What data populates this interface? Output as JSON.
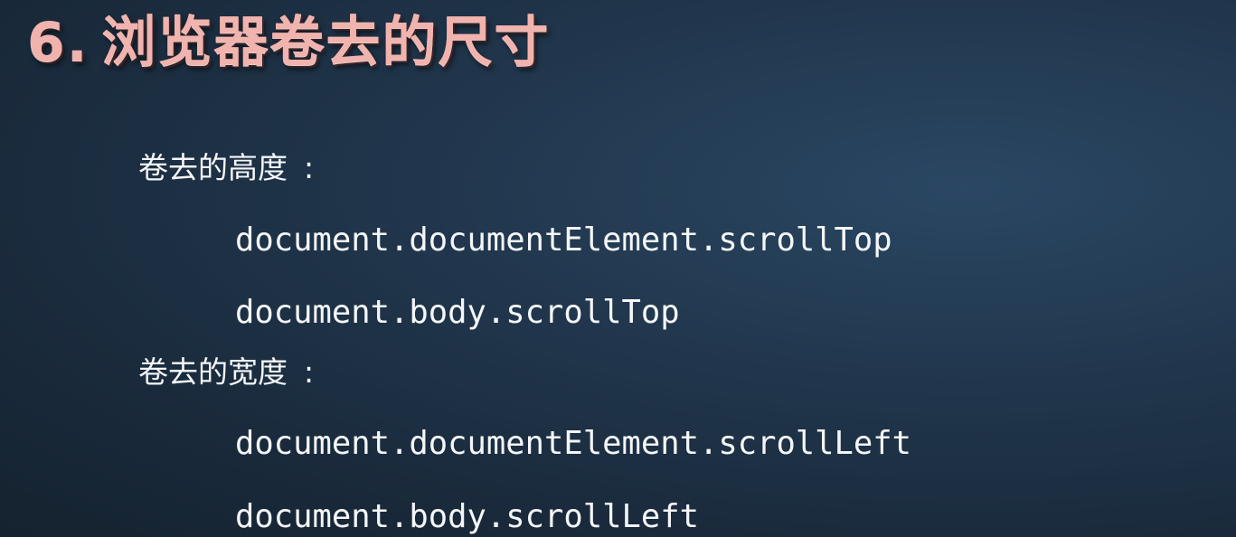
{
  "slide": {
    "title_number": "6.",
    "title_text": "浏览器卷去的尺寸",
    "sections": [
      {
        "heading": "卷去的高度",
        "colon": ":",
        "code_lines": [
          "document.documentElement.scrollTop",
          "document.body.scrollTop"
        ]
      },
      {
        "heading": "卷去的宽度",
        "colon": ":",
        "code_lines": [
          "document.documentElement.scrollLeft",
          "document.body.scrollLeft"
        ]
      }
    ]
  }
}
